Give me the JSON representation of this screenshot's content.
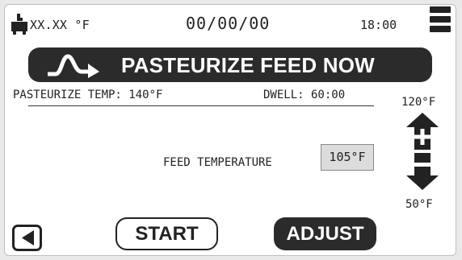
{
  "status_bar": {
    "icon": "feeder-tank-icon",
    "temperature": "XX.XX °F",
    "date": "00/00/00",
    "time": "18:00",
    "menu_icon": "hamburger-menu-icon"
  },
  "banner": {
    "icon": "pasteurize-curve-arrow-icon",
    "title": "PASTEURIZE FEED NOW"
  },
  "settings": {
    "pasteurize_temp": "PASTEURIZE TEMP: 140°F",
    "dwell": "DWELL: 60:00"
  },
  "range": {
    "max": "120°F",
    "min": "50°F",
    "plus_icon": "arrow-up-plus-icon",
    "minus_icon": "arrow-down-minus-icon"
  },
  "feed": {
    "label": "FEED TEMPERATURE",
    "value": "105°F"
  },
  "footer": {
    "back_icon": "back-triangle-icon",
    "start_label": "START",
    "adjust_label": "ADJUST"
  },
  "colors": {
    "dark": "#2b2b2b",
    "field_bg": "#dcdcdc",
    "screen_bg": "#ffffff"
  }
}
